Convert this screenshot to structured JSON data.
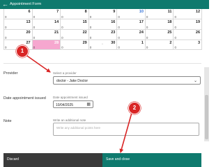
{
  "header": {
    "back_icon": "arrow-left-icon",
    "title": "Appointment Form"
  },
  "calendar": {
    "highlight_color": "#f6a7cf",
    "rows": [
      {
        "cells": [
          {
            "day": "6",
            "count": "0"
          },
          {
            "day": "7",
            "count": "0"
          },
          {
            "day": "8",
            "count": "0"
          },
          {
            "day": "9",
            "count": "0"
          },
          {
            "day": "10",
            "count": "0",
            "today": true
          },
          {
            "day": "11",
            "count": "0"
          },
          {
            "day": "12",
            "count": "0"
          }
        ]
      },
      {
        "cells": [
          {
            "day": "13",
            "count": "0"
          },
          {
            "day": "14",
            "count": "0"
          },
          {
            "day": "15",
            "count": "0"
          },
          {
            "day": "16",
            "count": "0"
          },
          {
            "day": "17",
            "count": "0"
          },
          {
            "day": "18",
            "count": "0"
          },
          {
            "day": "19",
            "count": "0"
          }
        ]
      },
      {
        "cells": [
          {
            "day": "20",
            "count": "0"
          },
          {
            "day": "21",
            "count": "0"
          },
          {
            "day": "22",
            "count": "0"
          },
          {
            "day": "23",
            "count": "0"
          },
          {
            "day": "24",
            "count": "0"
          },
          {
            "day": "25",
            "count": "0"
          },
          {
            "day": "26",
            "count": "0"
          }
        ]
      },
      {
        "cells": [
          {
            "day": "27",
            "count": "0"
          },
          {
            "day": "28",
            "count": "0",
            "highlight": true
          },
          {
            "day": "29",
            "count": "0"
          },
          {
            "day": "30",
            "count": "0"
          },
          {
            "day": "1",
            "count": "0"
          },
          {
            "day": "2",
            "count": "0"
          },
          {
            "day": "3",
            "count": "0"
          }
        ]
      }
    ],
    "pager": "-"
  },
  "provider": {
    "label": "Provider",
    "field_label": "Select a provider",
    "value": "doctor - Jake Doctor",
    "chevron_icon": "chevron-down-icon"
  },
  "date_issued": {
    "label": "Date appointment issued",
    "field_label": "Date appointment issued",
    "value": "10/04/2025",
    "calendar_icon": "calendar-icon"
  },
  "note": {
    "label": "Note",
    "field_label": "Write an additional note",
    "placeholder": "Write any additional points here"
  },
  "footer": {
    "discard_label": "Discard",
    "save_label": "Save and close"
  },
  "annotations": {
    "color": "#d92525",
    "badge_1": "1",
    "badge_2": "2"
  }
}
